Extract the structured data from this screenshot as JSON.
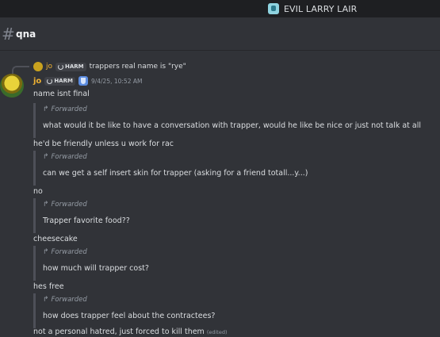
{
  "server": {
    "name": "EVIL LARRY LAIR",
    "icon": "server-icon"
  },
  "channel": {
    "hash": "#",
    "name": "qna"
  },
  "reply": {
    "author": "jo",
    "tag": "HARM",
    "text": "trappers real name is \"rye\""
  },
  "message": {
    "author": "jo",
    "tag": "HARM",
    "timestamp": "9/4/25, 10:52 AM",
    "first_line": "name isnt final"
  },
  "forward_label": "Forwarded",
  "forward_arrow": "↱",
  "thread": [
    {
      "forwarded": "what would it be like to have a conversation with trapper, would he like be nice or just not talk at all",
      "reply": "he'd be friendly unless u work for rac"
    },
    {
      "forwarded": "can we get a self insert skin for trapper (asking for a friend totall...y...)",
      "reply": "no"
    },
    {
      "forwarded": "Trapper favorite food??",
      "reply": "cheesecake"
    },
    {
      "forwarded": "how much will trapper cost?",
      "reply": "hes free"
    },
    {
      "forwarded": "how does trapper feel about the contractees?",
      "reply": "not a personal hatred, just forced to kill them"
    }
  ],
  "edited_label": "(edited)"
}
